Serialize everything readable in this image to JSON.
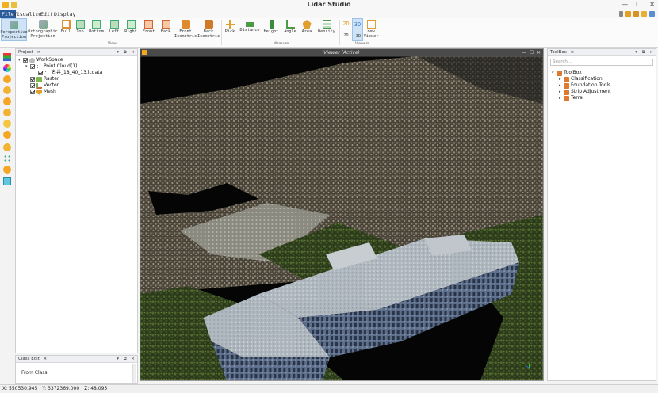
{
  "app": {
    "title": "Lidar Studio"
  },
  "menu": [
    {
      "label": "File",
      "active": true
    },
    {
      "label": "Visualize",
      "active": false
    },
    {
      "label": "Edit",
      "active": false
    },
    {
      "label": "Display",
      "active": false
    }
  ],
  "ribbon": {
    "view_buttons": [
      {
        "label": "Perspective\nProjection",
        "selected": true
      },
      {
        "label": "Orthographic\nProjection",
        "selected": false
      },
      {
        "label": "Full",
        "selected": false
      },
      {
        "label": "Top",
        "selected": false
      },
      {
        "label": "Bottom",
        "selected": false
      },
      {
        "label": "Left",
        "selected": false
      },
      {
        "label": "Right",
        "selected": false
      },
      {
        "label": "Front",
        "selected": false
      },
      {
        "label": "Back",
        "selected": false
      },
      {
        "label": "Front\nIsometric",
        "selected": false
      },
      {
        "label": "Back\nIsometric",
        "selected": false
      }
    ],
    "measure_buttons": [
      {
        "label": "Pick"
      },
      {
        "label": "Distance"
      },
      {
        "label": "Height"
      },
      {
        "label": "Angle"
      },
      {
        "label": "Area"
      },
      {
        "label": "Density"
      }
    ],
    "viewer_buttons": [
      {
        "label": "2D\n2D"
      },
      {
        "label": "3D\n3D"
      },
      {
        "label": "new\nViewer"
      }
    ],
    "groups": {
      "view": "View",
      "measure": "Measure",
      "viewers": "Viewers"
    }
  },
  "project": {
    "title": "Project",
    "tree": [
      {
        "label": "WorkSpace",
        "level": 0,
        "expander": "▾"
      },
      {
        "label": "Point Cloud(1)",
        "level": 1,
        "expander": "▾"
      },
      {
        "label": "名井_18_40_13.lcdata",
        "level": 2,
        "expander": ""
      },
      {
        "label": "Raster",
        "level": 1,
        "expander": ""
      },
      {
        "label": "Vector",
        "level": 1,
        "expander": ""
      },
      {
        "label": "Mesh",
        "level": 1,
        "expander": ""
      }
    ]
  },
  "class_edit": {
    "title": "Class Edit",
    "field_label": "From Class"
  },
  "viewer": {
    "title": "Viewer (Active)"
  },
  "toolbox": {
    "title": "ToolBox",
    "search_placeholder": "Search...",
    "tree": [
      {
        "label": "ToolBox",
        "level": 0,
        "expander": "▾"
      },
      {
        "label": "Classification",
        "level": 1,
        "expander": "▸"
      },
      {
        "label": "Foundation Tools",
        "level": 1,
        "expander": "▸"
      },
      {
        "label": "Strip Adjustment",
        "level": 1,
        "expander": "▸"
      },
      {
        "label": "Terra",
        "level": 1,
        "expander": "▸"
      }
    ]
  },
  "status": {
    "x": "X: 550530.945",
    "y": "Y: 3372369.000",
    "z": "Z: 48.095"
  },
  "colors": {
    "accent": "#2b5b9a",
    "selected_bg": "#cfe3f7",
    "icon_orange": "#f0a820"
  }
}
